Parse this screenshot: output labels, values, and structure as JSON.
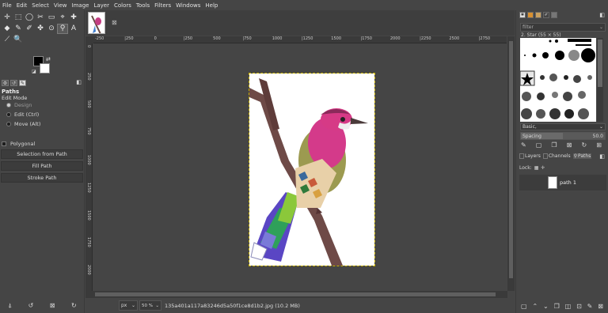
{
  "menu": [
    "File",
    "Edit",
    "Select",
    "View",
    "Image",
    "Layer",
    "Colors",
    "Tools",
    "Filters",
    "Windows",
    "Help"
  ],
  "toolbox": {
    "tools_row1": [
      "✛",
      "⬚",
      "◯",
      "✂",
      "▭",
      "⌖",
      "✚"
    ],
    "tools_row2": [
      "◆",
      "✎",
      "✐",
      "✤",
      "⊙",
      "⚲",
      "A"
    ],
    "tools_row3": [
      "⟋",
      "🔍"
    ],
    "color_swap": "⇄",
    "color_reset": "◪"
  },
  "tool_options": {
    "title": "Paths",
    "edit_mode_label": "Edit Mode",
    "mode_design": "Design",
    "mode_edit": "Edit (Ctrl)",
    "mode_move": "Move (Alt)",
    "polygonal": "Polygonal",
    "btn_selection": "Selection from Path",
    "btn_fill": "Fill Path",
    "btn_stroke": "Stroke Path"
  },
  "image": {
    "ruler_h_labels": [
      "-250",
      "|250",
      "0",
      "|250",
      "500",
      "|750",
      "1000",
      "|1250",
      "1500",
      "|1750",
      "2000",
      "|2250",
      "2500",
      "|2750"
    ],
    "ruler_v_labels": [
      "0",
      "250",
      "500",
      "750",
      "1000",
      "1250",
      "1500",
      "1750",
      "2000"
    ],
    "unit": "px",
    "zoom": "50 %",
    "filename": "135a401a117a83246d5a50f1ce8d1b2.jpg (10.2 MB)"
  },
  "brushes": {
    "filter_placeholder": "filter",
    "current_brush": "2. Star (55 × 55)",
    "tag": "Basic,",
    "spacing_label": "Spacing",
    "spacing_value": "50.0",
    "spacing_fraction": 0.5
  },
  "layers_panel": {
    "tabs": [
      "Layers",
      "Channels",
      "Paths"
    ],
    "lock_label": "Lock:",
    "path_name": "path 1"
  },
  "colors": {
    "fg": "#000000",
    "bg": "#ffffff",
    "selection": "#c9b200"
  }
}
